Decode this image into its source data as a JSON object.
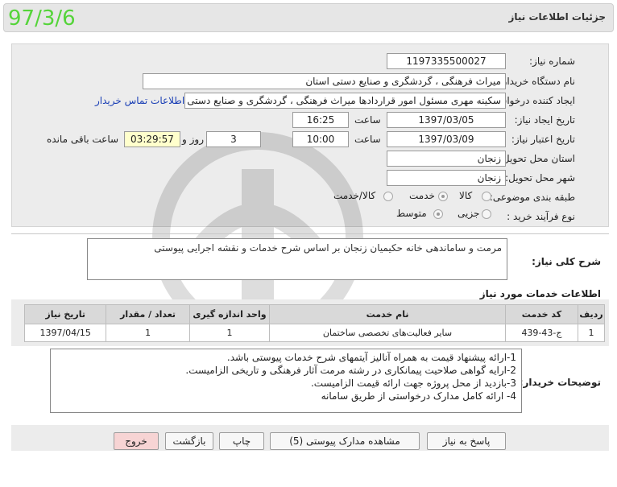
{
  "header": {
    "title": "جزئیات اطلاعات نیاز",
    "stamp_date": "97/3/6"
  },
  "form": {
    "need_number": {
      "label": "شماره نیاز:",
      "value": "1197335500027"
    },
    "buyer_org": {
      "label": "نام دستگاه خریدار:",
      "value": "میراث فرهنگی ، گردشگری و صنایع دستی استان"
    },
    "requester": {
      "label": "ایجاد کننده درخواست:",
      "value": "سکینه مهری مسئول امور قراردادها  میراث فرهنگی ، گردشگری و صنایع دستی",
      "contact_link": "اطلاعات تماس خریدار"
    },
    "created": {
      "label": "تاریخ ایجاد نیاز:",
      "date": "1397/03/05",
      "time_label": "ساعت",
      "time": "16:25"
    },
    "validity": {
      "label": "تاریخ اعتبار نیاز:",
      "date": "1397/03/09",
      "time_label": "ساعت",
      "time": "10:00",
      "days": "3",
      "days_label": "روز و",
      "remaining": "03:29:57",
      "remaining_label": "ساعت باقی مانده"
    },
    "province": {
      "label": "استان محل تحویل:",
      "value": "زنجان"
    },
    "city": {
      "label": "شهر محل تحویل:",
      "value": "زنجان"
    },
    "category": {
      "label": "طبقه بندی موضوعی:",
      "options": [
        "کالا",
        "خدمت",
        "کالا/خدمت"
      ],
      "selected": "خدمت"
    },
    "purchase_type": {
      "label": "نوع فرآیند خرید :",
      "options": [
        "جزیی",
        "متوسط"
      ],
      "selected": "متوسط"
    }
  },
  "description": {
    "label": "شرح کلی نیاز:",
    "text": "مرمت و ساماندهی خانه حکیمیان زنجان بر اساس شرح خدمات و نقشه اجرایی پیوستی"
  },
  "services": {
    "title": "اطلاعات خدمات مورد نیاز",
    "columns": [
      "ردیف",
      "کد خدمت",
      "نام خدمت",
      "واحد اندازه گیری",
      "تعداد / مقدار",
      "تاریخ نیاز"
    ],
    "rows": [
      [
        "1",
        "ج-43-439",
        "سایر فعالیت‌های تخصصی ساختمان",
        "1",
        "1",
        "1397/04/15"
      ]
    ]
  },
  "buyer_notes": {
    "label": "توضیحات خریدار:",
    "lines": [
      "1-ارائه پیشنهاد قیمت به همراه آنالیز آیتمهای شرح خدمات پیوستی باشد.",
      "2-ارایه گواهی صلاحیت پیمانکاری در رشته مرمت آثار فرهنگی و تاریخی الزامیست.",
      "3-بازدید از محل پروژه جهت ارائه قیمت الزامیست.",
      "4- ارائه کامل مدارک درخواستی از طریق سامانه"
    ]
  },
  "buttons": {
    "reply": "پاسخ به نیاز",
    "attachments": "مشاهده مدارک پیوستی (5)",
    "print": "چاپ",
    "back": "بازگشت",
    "exit": "خروج"
  },
  "colors": {
    "exit_bg": "#f7d4d4",
    "stamp": "#55d43a",
    "link": "#1a3fb5"
  }
}
